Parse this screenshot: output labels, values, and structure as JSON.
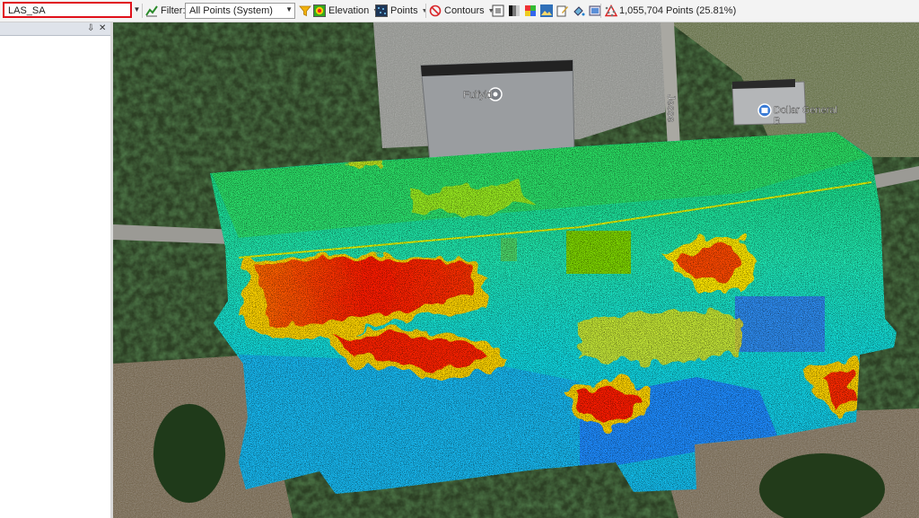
{
  "toolbar": {
    "layer_name": "LAS_SA",
    "filter_label": "Filter:",
    "filter_value": "All Points (System)",
    "elevation_label": "Elevation",
    "points_label": "Points",
    "contours_label": "Contours",
    "points_count": "1,055,704 Points (25.81%)"
  },
  "panel": {
    "pin_glyph": "⇩",
    "close_glyph": "✕"
  },
  "map": {
    "business_1": "Fulfyld",
    "road_name": "Jesse",
    "business_2_line1": "Dollar General",
    "business_2_line2": "B"
  },
  "colors": {
    "highlight_border": "#e0101a",
    "point_high": "#ff2a00",
    "point_mid": "#ffe800",
    "point_low": "#00e6e0",
    "point_ground": "#1e8cff"
  },
  "icons": [
    "filter-funnel-icon",
    "elevation-icon",
    "points-icon",
    "no-contours-icon",
    "layer-tool-icons",
    "points-count-icon"
  ]
}
